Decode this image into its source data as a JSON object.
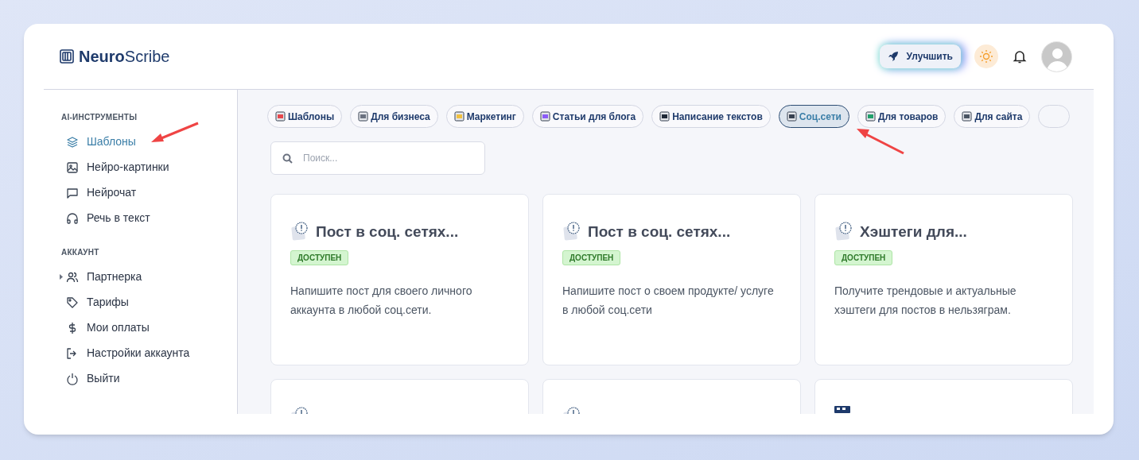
{
  "header": {
    "logo": {
      "bold": "Neuro",
      "light": "Scribe"
    },
    "upgrade_button": "Улучшить"
  },
  "sidebar": {
    "sections": [
      {
        "title": "AI-ИНСТРУМЕНТЫ",
        "items": [
          {
            "label": "Шаблоны",
            "selected": true,
            "kind": "link"
          },
          {
            "label": "Нейро-картинки",
            "selected": false,
            "kind": "link"
          },
          {
            "label": "Нейрочат",
            "selected": false,
            "kind": "link"
          },
          {
            "label": "Речь в текст",
            "selected": false,
            "kind": "link"
          }
        ]
      },
      {
        "title": "АККАУНТ",
        "items": [
          {
            "label": "Партнерка",
            "selected": false,
            "kind": "group"
          },
          {
            "label": "Тарифы",
            "selected": false,
            "kind": "link"
          },
          {
            "label": "Мои оплаты",
            "selected": false,
            "kind": "link"
          },
          {
            "label": "Настройки аккаунта",
            "selected": false,
            "kind": "link"
          },
          {
            "label": "Выйти",
            "selected": false,
            "kind": "link"
          }
        ]
      }
    ]
  },
  "categories": [
    {
      "label": "Шаблоны",
      "selected": false
    },
    {
      "label": "Для бизнеса",
      "selected": false
    },
    {
      "label": "Маркетинг",
      "selected": false
    },
    {
      "label": "Статьи для блога",
      "selected": false
    },
    {
      "label": "Написание текстов",
      "selected": false
    },
    {
      "label": "Соц.сети",
      "selected": true
    },
    {
      "label": "Для товаров",
      "selected": false
    },
    {
      "label": "Для сайта",
      "selected": false
    }
  ],
  "search": {
    "placeholder": "Поиск..."
  },
  "cards": [
    {
      "kind": "clock",
      "title": "Пост в соц. сетях...",
      "badge": "ДОСТУПЕН",
      "description": "Напишите пост для своего личного аккаунта в любой соц.сети."
    },
    {
      "kind": "clock",
      "title": "Пост в соц. сетях...",
      "badge": "ДОСТУПЕН",
      "description": "Напишите пост о своем продукте/ услуге в любой соц.сети"
    },
    {
      "kind": "clock",
      "title": "Хэштеги для...",
      "badge": "ДОСТУПЕН",
      "description": "Получите трендовые и актуальные хэштеги для постов в нельзяграм."
    },
    {
      "kind": "clock"
    },
    {
      "kind": "clock"
    },
    {
      "kind": "ticket"
    }
  ]
}
